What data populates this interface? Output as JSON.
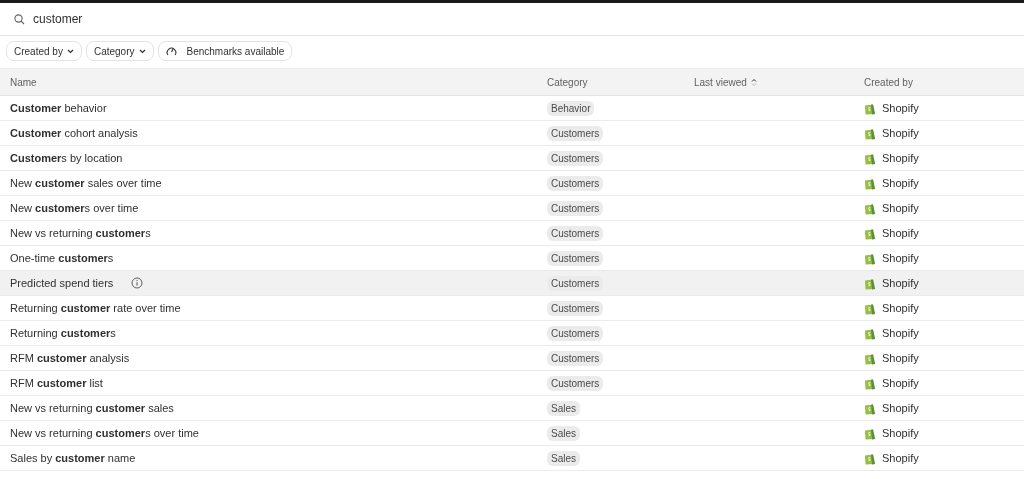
{
  "search": {
    "value": "customer"
  },
  "filters": [
    {
      "kind": "dropdown",
      "label": "Created by"
    },
    {
      "kind": "dropdown",
      "label": "Category"
    },
    {
      "kind": "gauge",
      "label": "Benchmarks available"
    }
  ],
  "table": {
    "columns": [
      {
        "label": "Name",
        "sortable": false
      },
      {
        "label": "Category",
        "sortable": false
      },
      {
        "label": "Last viewed",
        "sortable": true
      },
      {
        "label": "Created by",
        "sortable": false
      }
    ],
    "rows": [
      {
        "name": "**Customer** behavior",
        "category": "Behavior",
        "created_by": "Shopify",
        "selected": false,
        "info": false
      },
      {
        "name": "**Customer** cohort analysis",
        "category": "Customers",
        "created_by": "Shopify",
        "selected": false,
        "info": false
      },
      {
        "name": "**Customer**s by location",
        "category": "Customers",
        "created_by": "Shopify",
        "selected": false,
        "info": false
      },
      {
        "name": "New **customer** sales over time",
        "category": "Customers",
        "created_by": "Shopify",
        "selected": false,
        "info": false
      },
      {
        "name": "New **customer**s over time",
        "category": "Customers",
        "created_by": "Shopify",
        "selected": false,
        "info": false
      },
      {
        "name": "New vs returning **customer**s",
        "category": "Customers",
        "created_by": "Shopify",
        "selected": false,
        "info": false
      },
      {
        "name": "One-time **customer**s",
        "category": "Customers",
        "created_by": "Shopify",
        "selected": false,
        "info": false
      },
      {
        "name": "Predicted spend tiers",
        "category": "Customers",
        "created_by": "Shopify",
        "selected": true,
        "info": true
      },
      {
        "name": "Returning **customer** rate over time",
        "category": "Customers",
        "created_by": "Shopify",
        "selected": false,
        "info": false
      },
      {
        "name": "Returning **customer**s",
        "category": "Customers",
        "created_by": "Shopify",
        "selected": false,
        "info": false
      },
      {
        "name": "RFM **customer** analysis",
        "category": "Customers",
        "created_by": "Shopify",
        "selected": false,
        "info": false
      },
      {
        "name": "RFM **customer** list",
        "category": "Customers",
        "created_by": "Shopify",
        "selected": false,
        "info": false
      },
      {
        "name": "New vs returning **customer** sales",
        "category": "Sales",
        "created_by": "Shopify",
        "selected": false,
        "info": false
      },
      {
        "name": "New vs returning **customer**s over time",
        "category": "Sales",
        "created_by": "Shopify",
        "selected": false,
        "info": false
      },
      {
        "name": "Sales by **customer** name",
        "category": "Sales",
        "created_by": "Shopify",
        "selected": false,
        "info": false
      }
    ]
  }
}
